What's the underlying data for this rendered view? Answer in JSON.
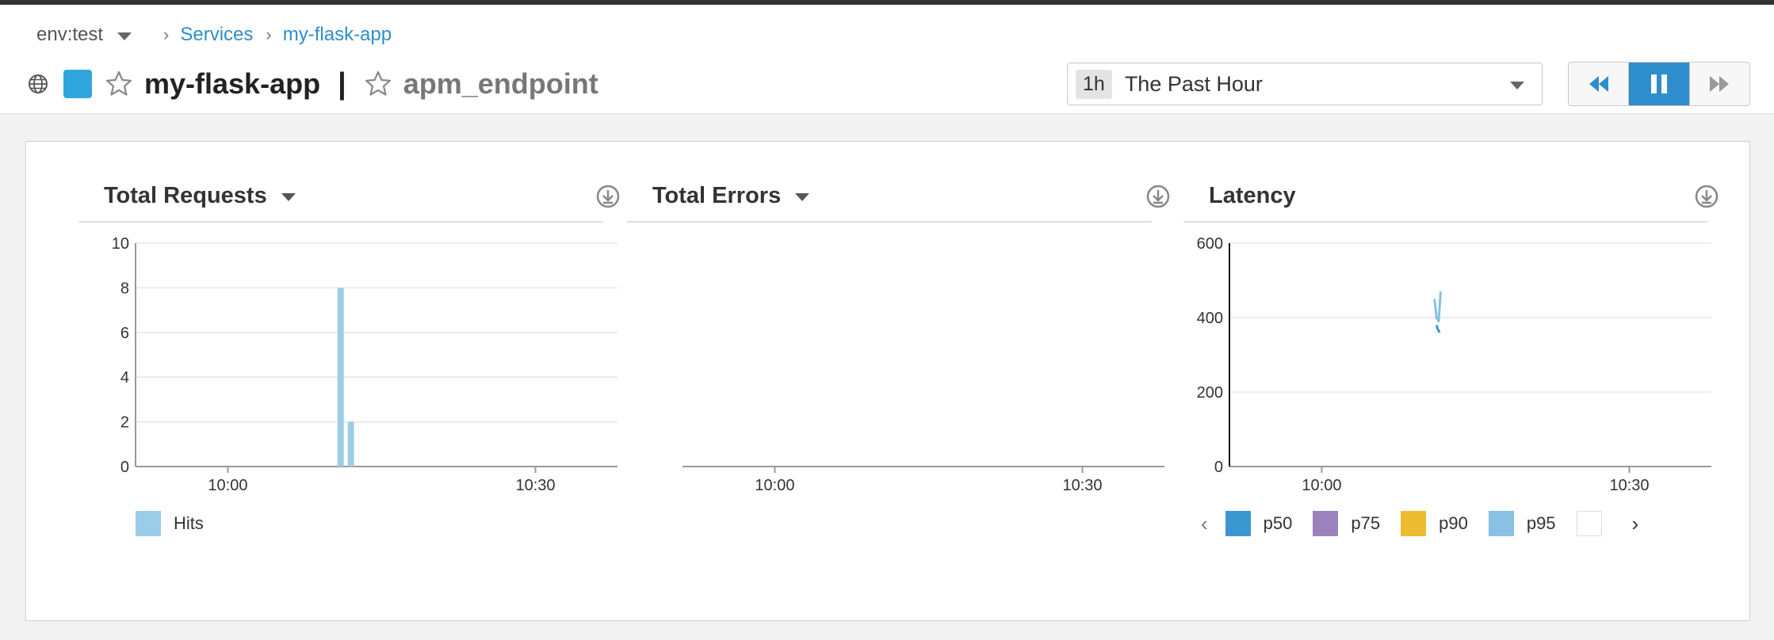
{
  "breadcrumb": {
    "env": "env:test",
    "services": "Services",
    "service": "my-flask-app"
  },
  "title": {
    "service": "my-flask-app",
    "separator": "|",
    "resource": "apm_endpoint"
  },
  "time_selector": {
    "badge": "1h",
    "label": "The Past Hour"
  },
  "colors": {
    "accent": "#2e8ecb",
    "service_swatch": "#2fa7dd",
    "hits": "#9bcde8",
    "p50": "#3b97d0",
    "p75": "#9b81be",
    "p90": "#ecbb2f",
    "p95": "#87c1e3"
  },
  "widgets": [
    {
      "title": "Total Requests"
    },
    {
      "title": "Total Errors"
    },
    {
      "title": "Latency"
    }
  ],
  "chart_data": [
    {
      "type": "bar",
      "title": "Total Requests",
      "x_ticks": [
        "10:00",
        "10:30"
      ],
      "y_ticks": [
        "0",
        "2",
        "4",
        "6",
        "8",
        "10"
      ],
      "ylim": [
        0,
        10
      ],
      "grid": true,
      "legend_position": "bottom-left",
      "series": [
        {
          "name": "Hits",
          "points": [
            {
              "x": "10:11",
              "y": 8
            },
            {
              "x": "10:12",
              "y": 2
            }
          ]
        }
      ]
    },
    {
      "type": "bar",
      "title": "Total Errors",
      "x_ticks": [
        "10:00",
        "10:30"
      ],
      "y_ticks": [],
      "series": []
    },
    {
      "type": "line",
      "title": "Latency",
      "x_ticks": [
        "10:00",
        "10:30"
      ],
      "y_ticks": [
        "0",
        "200",
        "400",
        "600"
      ],
      "ylim": [
        0,
        600
      ],
      "grid": true,
      "legend_position": "bottom",
      "legend": [
        "p50",
        "p75",
        "p90",
        "p95"
      ],
      "series": [
        {
          "name": "p50",
          "points": [
            {
              "x": "10:11.2",
              "y": 380
            },
            {
              "x": "10:11.3",
              "y": 370
            },
            {
              "x": "10:11.5",
              "y": 360
            }
          ]
        },
        {
          "name": "p95",
          "points": [
            {
              "x": "10:11.0",
              "y": 450
            },
            {
              "x": "10:11.2",
              "y": 400
            },
            {
              "x": "10:11.4",
              "y": 390
            },
            {
              "x": "10:11.6",
              "y": 470
            }
          ]
        }
      ]
    }
  ]
}
